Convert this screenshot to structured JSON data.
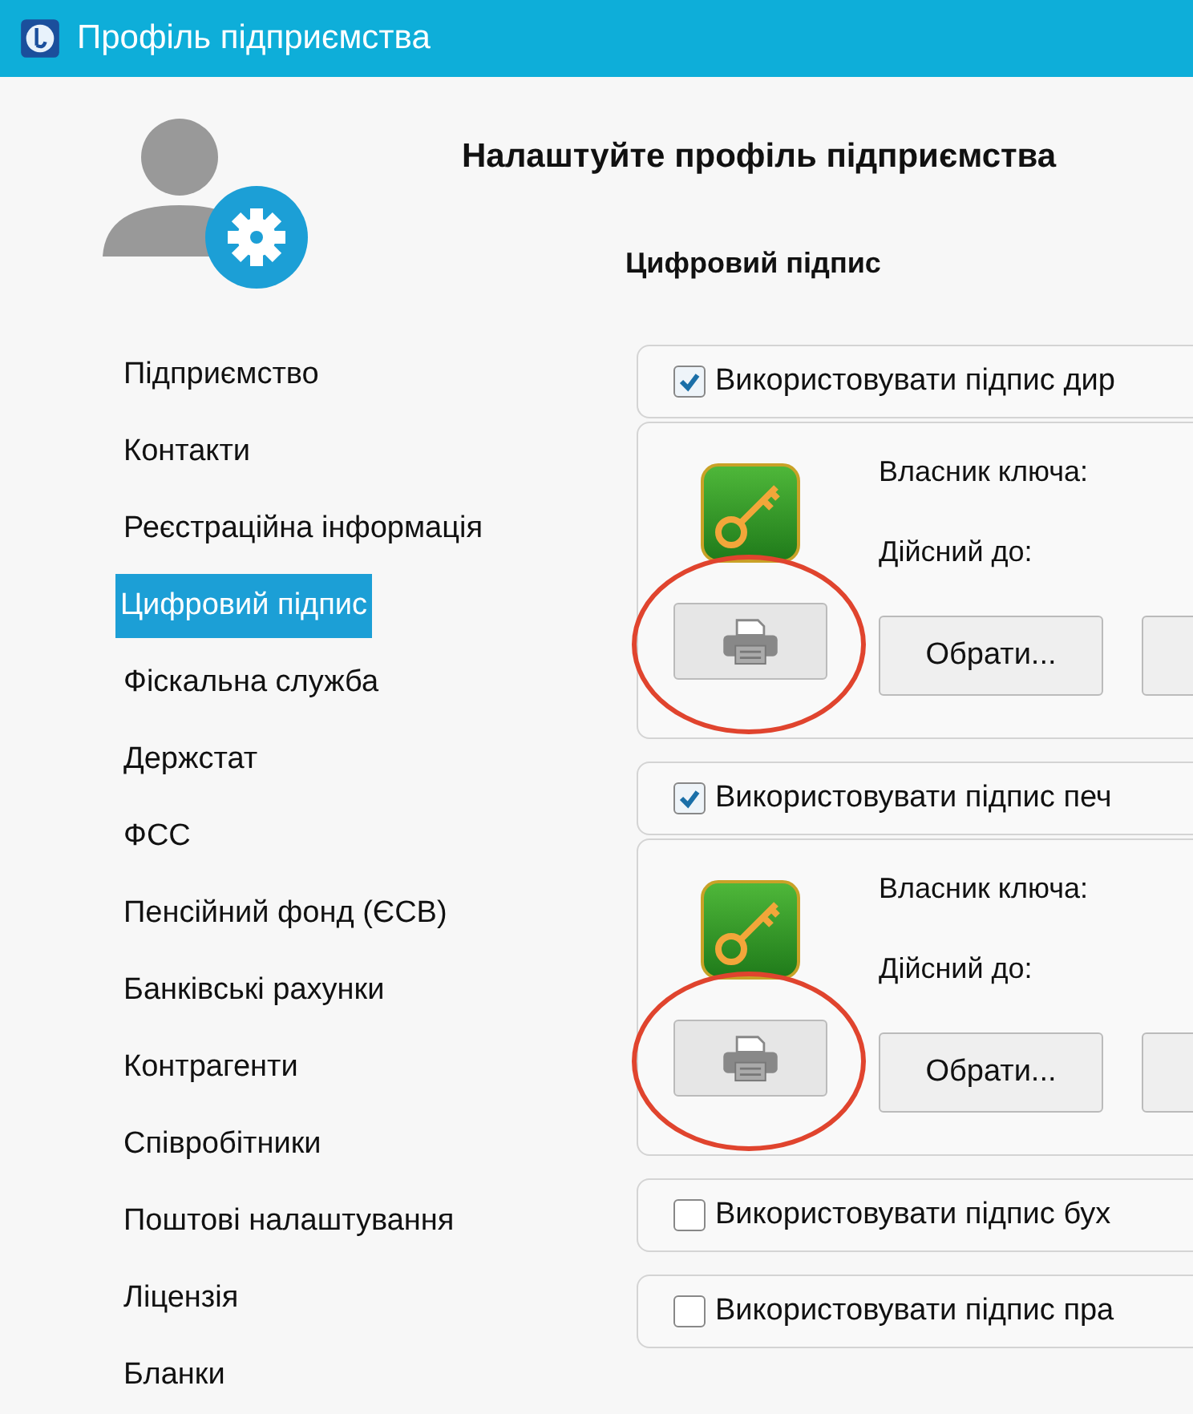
{
  "window": {
    "title": "Профіль підприємства"
  },
  "sidebar": {
    "items": [
      {
        "label": "Підприємство",
        "selected": false
      },
      {
        "label": "Контакти",
        "selected": false
      },
      {
        "label": "Реєстраційна інформація",
        "selected": false
      },
      {
        "label": "Цифровий підпис",
        "selected": true
      },
      {
        "label": "Фіскальна служба",
        "selected": false
      },
      {
        "label": "Держстат",
        "selected": false
      },
      {
        "label": "ФСС",
        "selected": false
      },
      {
        "label": "Пенсійний фонд (ЄСВ)",
        "selected": false
      },
      {
        "label": "Банківські рахунки",
        "selected": false
      },
      {
        "label": "Контрагенти",
        "selected": false
      },
      {
        "label": "Співробітники",
        "selected": false
      },
      {
        "label": "Поштові налаштування",
        "selected": false
      },
      {
        "label": "Ліцензія",
        "selected": false
      },
      {
        "label": "Бланки",
        "selected": false
      }
    ]
  },
  "heading": "Налаштуйте профіль підприємства",
  "section_title": "Цифровий підпис",
  "signatures": [
    {
      "label": "Використовувати підпис дир",
      "checked": true,
      "panel": {
        "owner_label": "Власник ключа:",
        "valid_label": "Дійсний до:",
        "choose_button": "Обрати...",
        "print_highlighted": true
      }
    },
    {
      "label": "Використовувати підпис печ",
      "checked": true,
      "panel": {
        "owner_label": "Власник ключа:",
        "valid_label": "Дійсний до:",
        "choose_button": "Обрати...",
        "print_highlighted": true
      }
    },
    {
      "label": "Використовувати підпис бух",
      "checked": false
    },
    {
      "label": "Використовувати підпис пра",
      "checked": false
    }
  ]
}
